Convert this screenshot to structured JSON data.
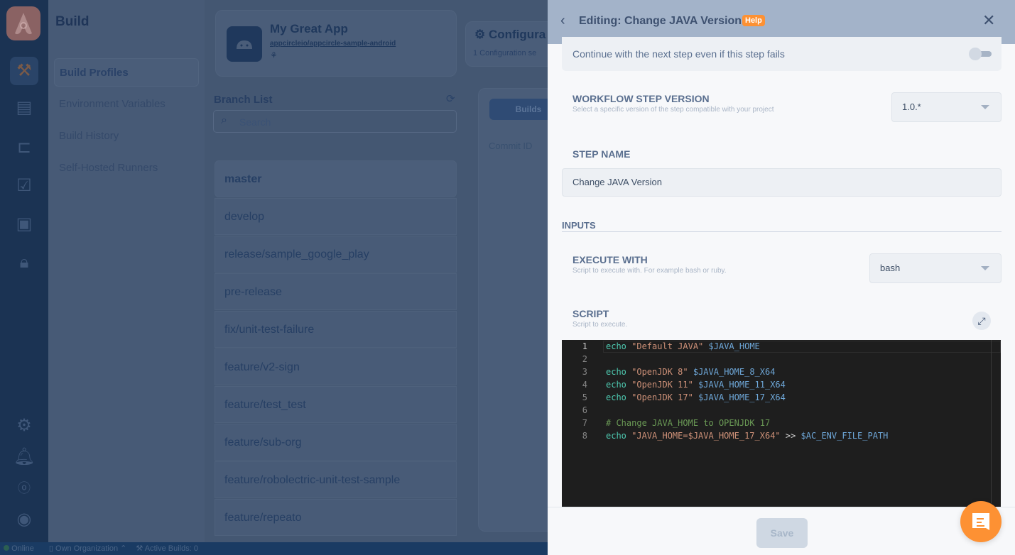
{
  "sidebar": {
    "section_title": "Build",
    "items": [
      {
        "label": "Build Profiles"
      },
      {
        "label": "Environment Variables"
      },
      {
        "label": "Build History"
      },
      {
        "label": "Self-Hosted Runners"
      }
    ]
  },
  "app": {
    "name": "My Great App",
    "repo": "appcircleio/appcircle-sample-android"
  },
  "config": {
    "title": "Configura",
    "subtitle": "1 Configuration se"
  },
  "branch_list": {
    "title": "Branch List",
    "search_placeholder": "Search",
    "branches": [
      "master",
      "develop",
      "release/sample_google_play",
      "pre-release",
      "fix/unit-test-failure",
      "feature/v2-sign",
      "feature/test_test",
      "feature/sub-org",
      "feature/robolectric-unit-test-sample",
      "feature/repeato"
    ]
  },
  "builds": {
    "tab": "Builds",
    "column": "Commit ID"
  },
  "status_bar": {
    "online": "Online",
    "org": "Own Organization",
    "active_builds": "Active Builds: 0"
  },
  "drawer": {
    "title": "Editing: Change JAVA Version",
    "help": "Help",
    "continue_label": "Continue with the next step even if this step fails",
    "continue_on": false,
    "version_label": "WORKFLOW STEP VERSION",
    "version_desc": "Select a specific version of the step compatible with your project",
    "version_value": "1.0.*",
    "step_name_label": "STEP NAME",
    "step_name_value": "Change JAVA Version",
    "inputs_label": "INPUTS",
    "execute_label": "EXECUTE WITH",
    "execute_desc": "Script to execute with. For example bash or ruby.",
    "execute_value": "bash",
    "script_label": "SCRIPT",
    "script_desc": "Script to execute.",
    "script_lines": [
      [
        [
          "k",
          "echo "
        ],
        [
          "s",
          "\"Default JAVA\""
        ],
        [
          "o",
          " "
        ],
        [
          "v",
          "$JAVA_HOME"
        ]
      ],
      [],
      [
        [
          "k",
          "echo "
        ],
        [
          "s",
          "\"OpenJDK 8\""
        ],
        [
          "o",
          " "
        ],
        [
          "v",
          "$JAVA_HOME_8_X64"
        ]
      ],
      [
        [
          "k",
          "echo "
        ],
        [
          "s",
          "\"OpenJDK 11\""
        ],
        [
          "o",
          " "
        ],
        [
          "v",
          "$JAVA_HOME_11_X64"
        ]
      ],
      [
        [
          "k",
          "echo "
        ],
        [
          "s",
          "\"OpenJDK 17\""
        ],
        [
          "o",
          " "
        ],
        [
          "v",
          "$JAVA_HOME_17_X64"
        ]
      ],
      [],
      [
        [
          "c",
          "# Change JAVA_HOME to OPENJDK 17"
        ]
      ],
      [
        [
          "k",
          "echo "
        ],
        [
          "s",
          "\"JAVA_HOME=$JAVA_HOME_17_X64\""
        ],
        [
          "o",
          " >> "
        ],
        [
          "v",
          "$AC_ENV_FILE_PATH"
        ]
      ]
    ],
    "save": "Save"
  },
  "colors": {
    "accent": "#fd9133",
    "help_badge": "#fd9133",
    "header": "#a3b3c9"
  }
}
